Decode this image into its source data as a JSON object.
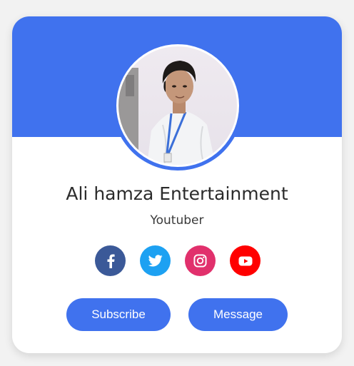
{
  "profile": {
    "name": "Ali hamza Entertainment",
    "role": "Youtuber"
  },
  "socials": [
    {
      "icon": "facebook-icon",
      "color": "#3b5998"
    },
    {
      "icon": "twitter-icon",
      "color": "#1da1f2"
    },
    {
      "icon": "instagram-icon",
      "color": "#e1306c"
    },
    {
      "icon": "youtube-icon",
      "color": "#ff0000"
    }
  ],
  "actions": {
    "subscribe_label": "Subscribe",
    "message_label": "Message"
  },
  "colors": {
    "accent": "#4072ee",
    "background": "#f2f2f2",
    "card": "#ffffff"
  }
}
